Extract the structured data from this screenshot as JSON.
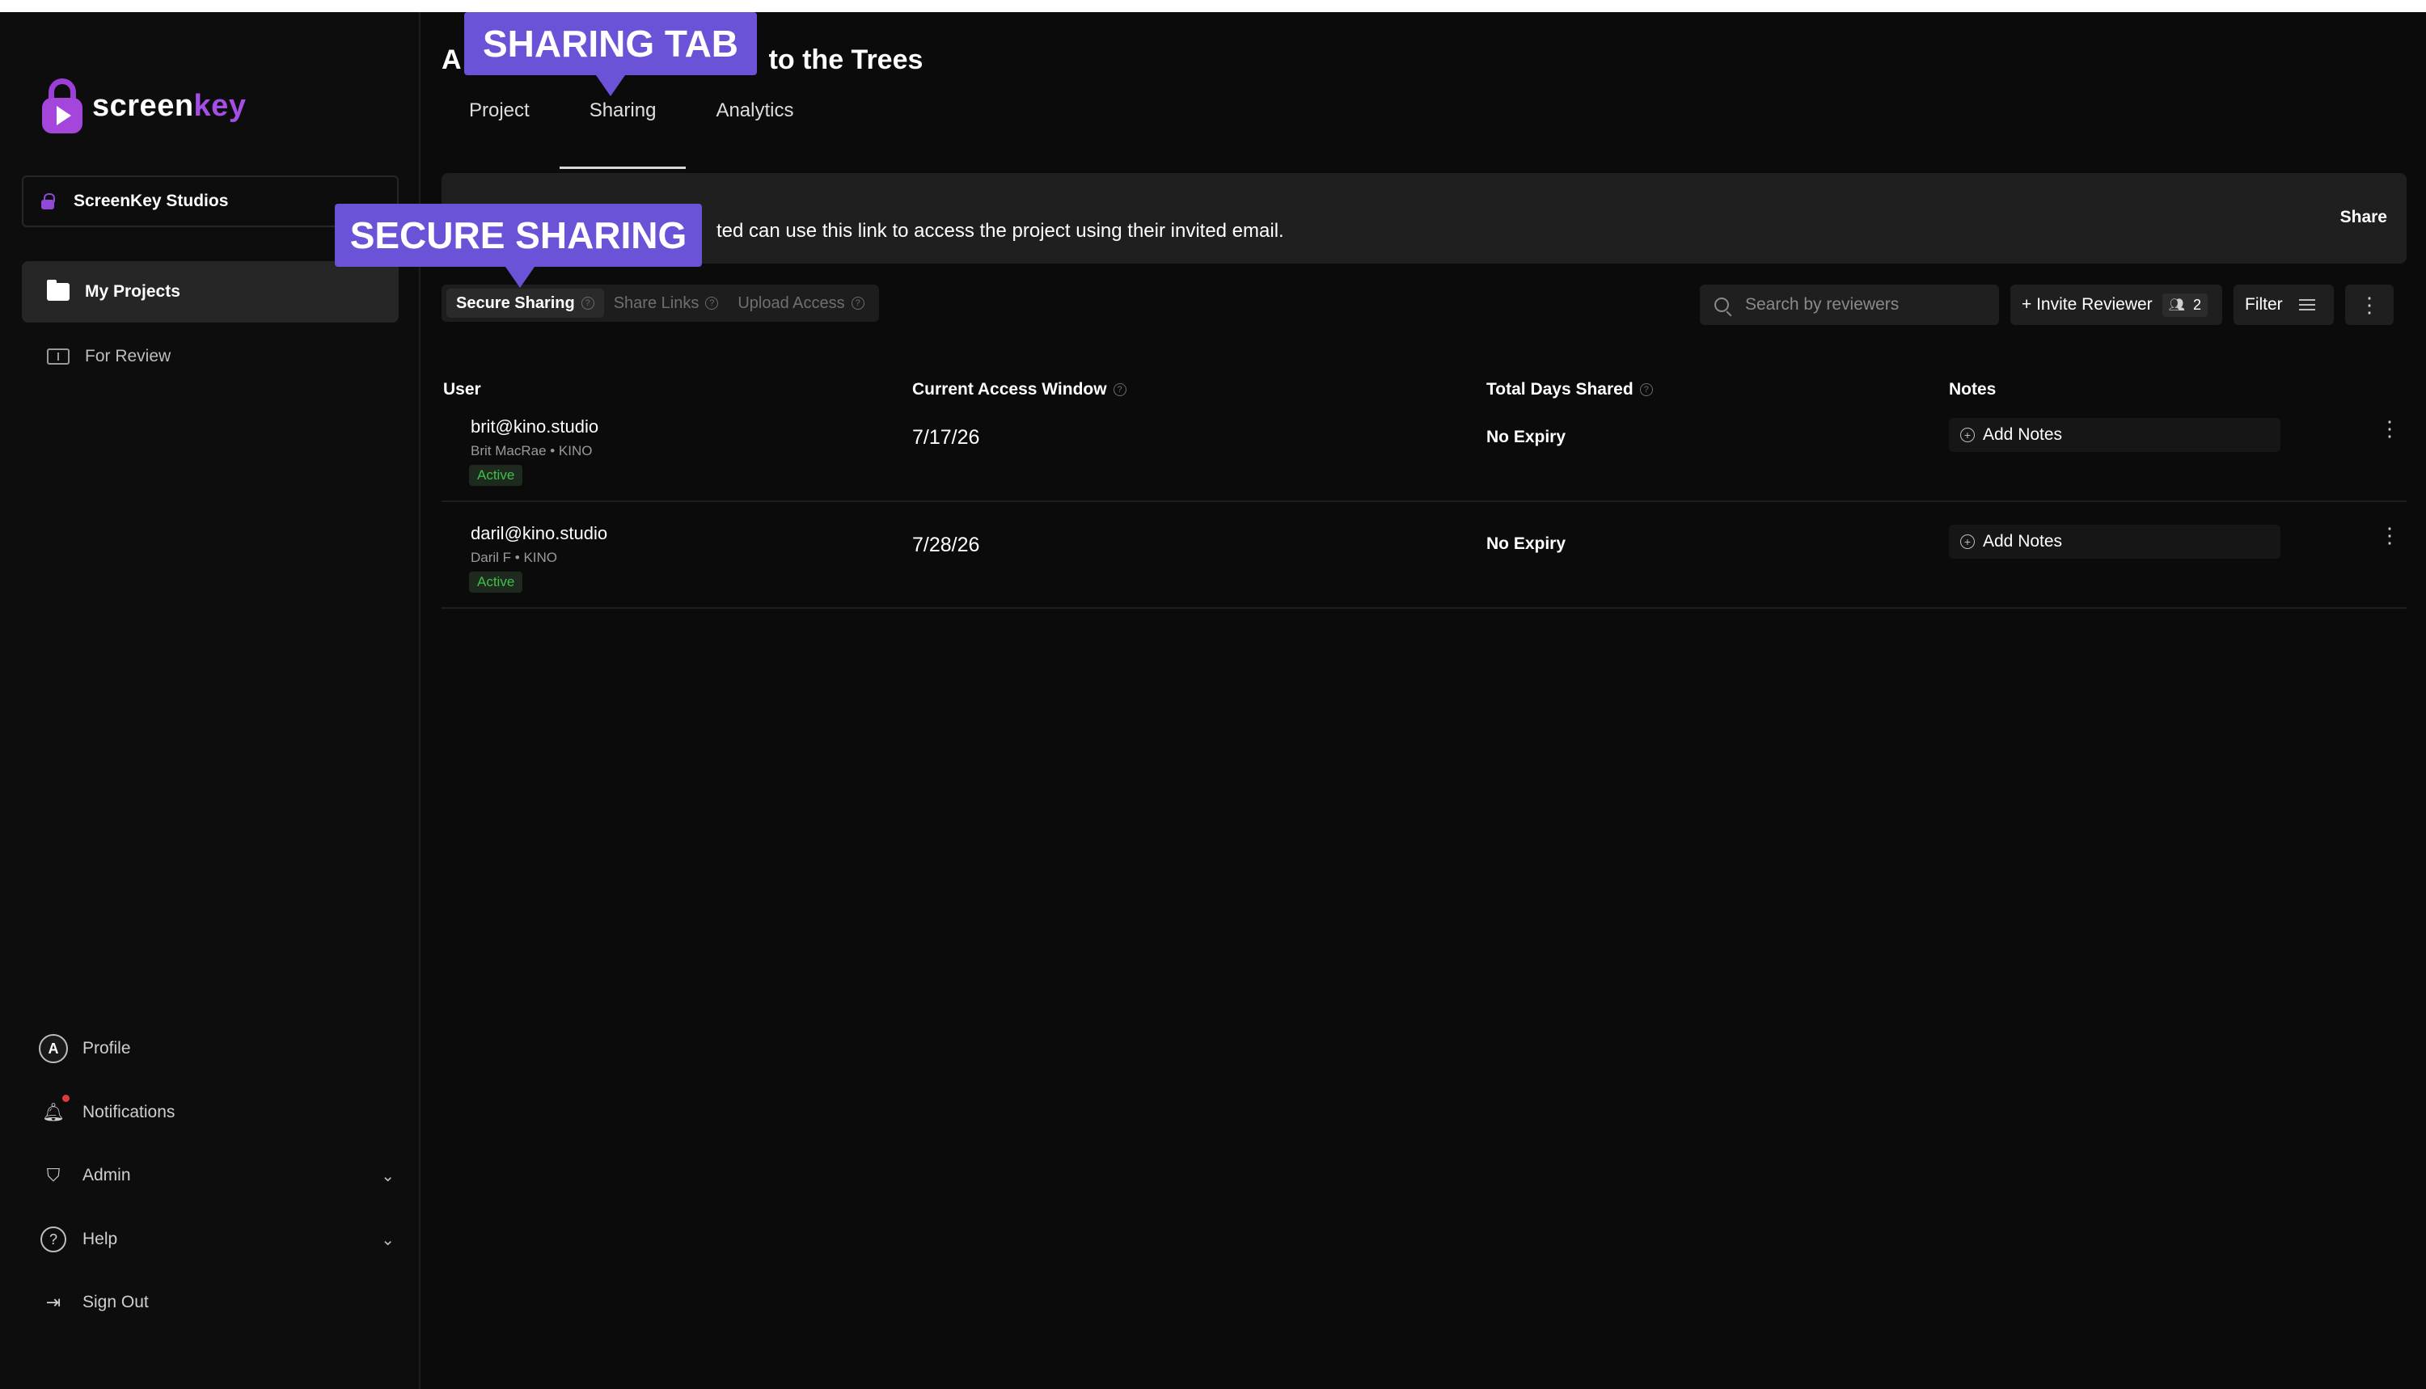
{
  "brand": {
    "name_white": "screen",
    "name_purple": "key"
  },
  "sidebar": {
    "org": "ScreenKey Studios",
    "nav": [
      {
        "label": "My Projects"
      },
      {
        "label": "For Review"
      }
    ],
    "bottom": [
      {
        "label": "Profile",
        "avatar_letter": "A"
      },
      {
        "label": "Notifications"
      },
      {
        "label": "Admin"
      },
      {
        "label": "Help"
      },
      {
        "label": "Sign Out"
      }
    ]
  },
  "header": {
    "title_prefix": "A",
    "title_suffix": "to the Trees",
    "tabs": [
      "Project",
      "Sharing",
      "Analytics"
    ]
  },
  "banner": {
    "text": "ted can use this link to access the project using their invited email.",
    "share_label": "Share"
  },
  "subtabs": [
    "Secure Sharing",
    "Share Links",
    "Upload Access"
  ],
  "toolbar": {
    "search_placeholder": "Search by reviewers",
    "invite_label": "+ Invite Reviewer",
    "invite_count": "2",
    "filter_label": "Filter"
  },
  "table": {
    "columns": [
      "User",
      "Current Access Window",
      "Total Days Shared",
      "Notes"
    ],
    "rows": [
      {
        "email": "brit@kino.studio",
        "meta": "Brit MacRae • KINO",
        "status": "Active",
        "date": "7/17/26",
        "expiry": "No Expiry",
        "notes": "Add Notes"
      },
      {
        "email": "daril@kino.studio",
        "meta": "Daril F • KINO",
        "status": "Active",
        "date": "7/28/26",
        "expiry": "No Expiry",
        "notes": "Add Notes"
      }
    ]
  },
  "callouts": {
    "sharing_tab": "SHARING TAB",
    "secure_sharing": "SECURE SHARING"
  },
  "colors": {
    "accent": "#6b52d6",
    "brand_purple": "#a445dc",
    "active_green": "#3fbf4b",
    "background": "#0b0b0b"
  }
}
